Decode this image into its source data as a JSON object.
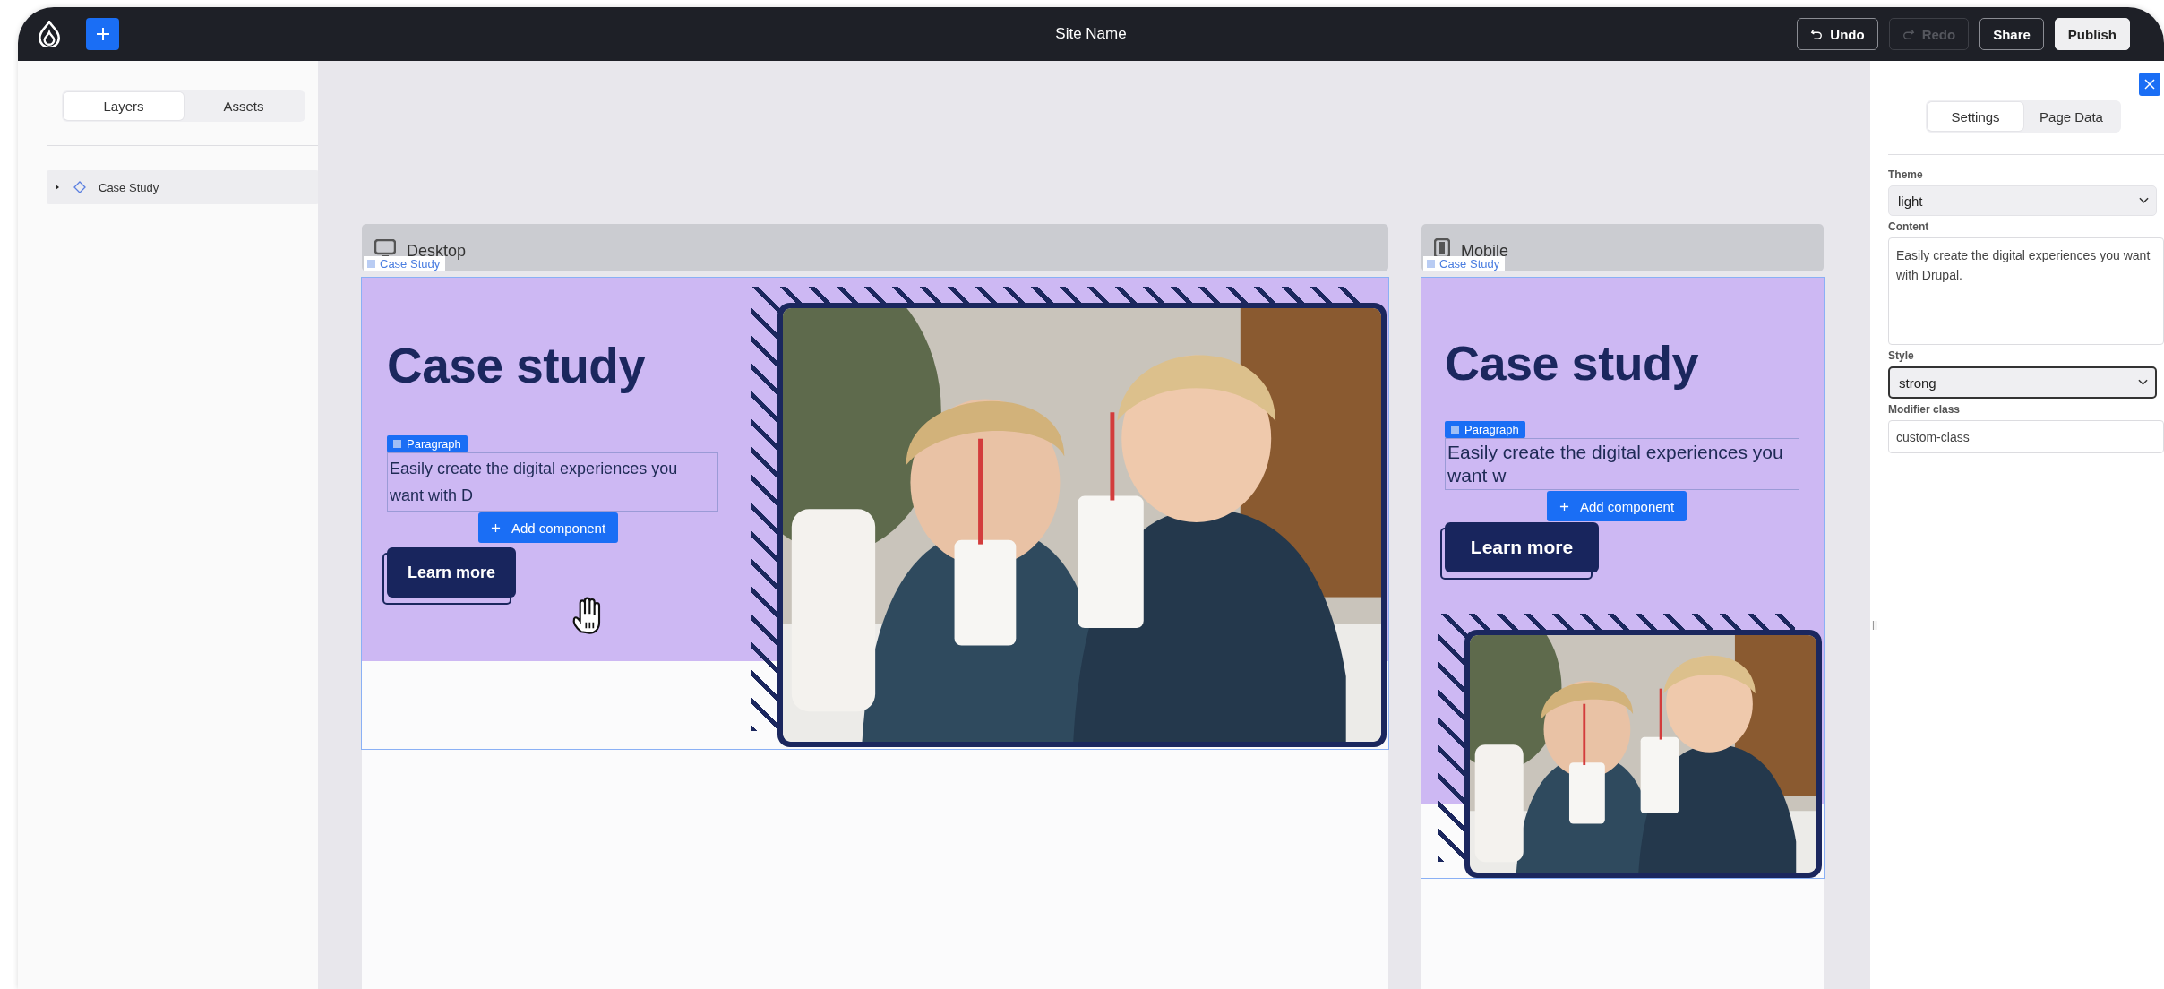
{
  "topbar": {
    "site_name": "Site Name",
    "actions": [
      {
        "label": "Undo",
        "kind": "undo",
        "disabled": false
      },
      {
        "label": "Redo",
        "kind": "redo",
        "disabled": true
      },
      {
        "label": "Share",
        "kind": "plain",
        "disabled": false
      },
      {
        "label": "Publish",
        "kind": "primary",
        "disabled": false
      }
    ]
  },
  "left_panel": {
    "tabs": [
      {
        "label": "Layers",
        "selected": true
      },
      {
        "label": "Assets",
        "selected": false
      }
    ],
    "layers": [
      {
        "label": "Case Study",
        "expanded": false
      }
    ]
  },
  "canvas": {
    "frames": [
      {
        "kind": "desktop",
        "label": "Desktop",
        "component_tag": "Case Study",
        "heading": "Case study",
        "paragraph_tag": "Paragraph",
        "paragraph": "Easily create the digital experiences you want with D",
        "add_button": "Add component",
        "cta": "Learn more"
      },
      {
        "kind": "mobile",
        "label": "Mobile",
        "component_tag": "Case Study",
        "heading": "Case study",
        "paragraph_tag": "Paragraph",
        "paragraph": "Easily create the digital experiences you want w",
        "add_button": "Add component",
        "cta": "Learn more"
      }
    ]
  },
  "right_panel": {
    "tabs": [
      {
        "label": "Settings",
        "selected": true
      },
      {
        "label": "Page Data",
        "selected": false
      }
    ],
    "fields": [
      {
        "kind": "select",
        "label": "Theme",
        "value": "light",
        "focused": false
      },
      {
        "kind": "textarea",
        "label": "Content",
        "value": "Easily create the digital experiences you want with Drupal.",
        "focused": false
      },
      {
        "kind": "select",
        "label": "Style",
        "value": "strong",
        "focused": true
      },
      {
        "kind": "text",
        "label": "Modifier class",
        "value": "custom-class",
        "focused": false
      }
    ]
  }
}
